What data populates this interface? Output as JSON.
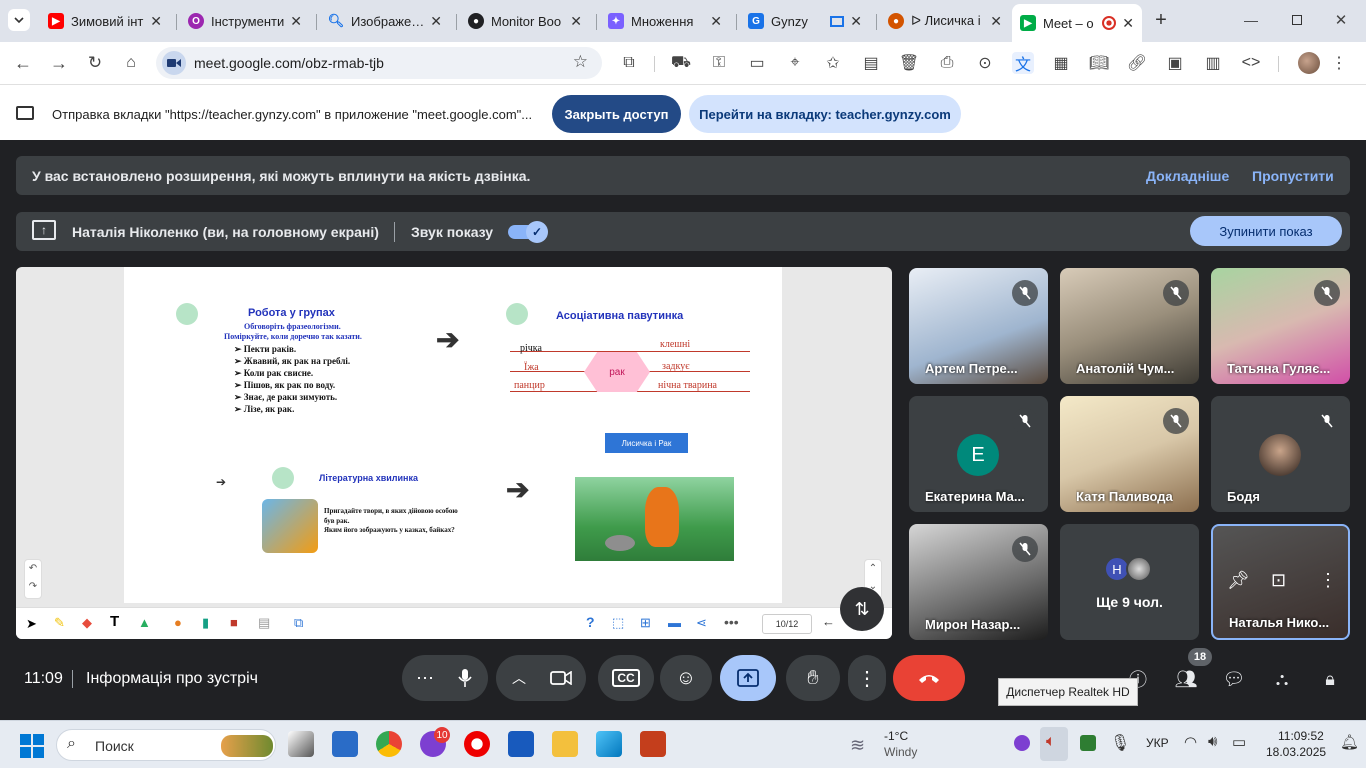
{
  "browser": {
    "tabs": [
      {
        "title": "Зимовий інт",
        "favicon": "youtube-icon",
        "color": "#ff0000"
      },
      {
        "title": "Інструменти",
        "favicon": "opera-icon",
        "color": "#9c27b0"
      },
      {
        "title": "Изображени",
        "favicon": "search-icon",
        "color": "#1a73e8"
      },
      {
        "title": "Monitor Boo",
        "favicon": "monitor-icon",
        "color": "#202124"
      },
      {
        "title": "Множення",
        "favicon": "app-icon",
        "color": "#7b61ff"
      },
      {
        "title": "Gynzy",
        "favicon": "gynzy-icon",
        "color": "#1a73e8"
      },
      {
        "title": "ᐅ Лисичка і",
        "favicon": "acorn-icon",
        "color": "#d35400"
      },
      {
        "title": "Meet – o",
        "favicon": "meet-icon",
        "color": "#00ac47"
      }
    ],
    "url": "meet.google.com/obz-rmab-tjb"
  },
  "infobar": {
    "message": "Отправка вкладки \"https://teacher.gynzy.com\" в приложение \"meet.google.com\"...",
    "stop_label": "Закрыть доступ",
    "goto_label": "Перейти на вкладку: teacher.gynzy.com"
  },
  "meet": {
    "extension_warning": "У вас встановлено розширення, які можуть вплинути на якість дзвінка.",
    "learn_more": "Докладніше",
    "skip": "Пропустити",
    "presenter": "Наталія Ніколенко (ви, на головному екрані)",
    "share_audio": "Звук показу",
    "stop_presenting": "Зупинити показ",
    "time": "11:09",
    "meeting_info": "Інформація про зустріч",
    "participant_count": "18",
    "tooltip": "Диспетчер Realtek HD",
    "participants": [
      {
        "name": "Артем Петре...",
        "muted": true
      },
      {
        "name": "Анатолій Чум...",
        "muted": true
      },
      {
        "name": "Татьяна Гуляє...",
        "muted": true
      },
      {
        "name": "Екатерина Ма...",
        "muted": true,
        "initial": "Е",
        "color": "#00897b"
      },
      {
        "name": "Катя Паливода",
        "muted": true
      },
      {
        "name": "Бодя",
        "muted": true
      },
      {
        "name": "Мирон Назар...",
        "muted": true
      },
      {
        "name": "Ще 9 чол.",
        "initial": "Н",
        "color": "#3f51b5"
      },
      {
        "name": "Наталья Нико..."
      }
    ]
  },
  "slide": {
    "title1": "Робота у групах",
    "subtitle1": "Обговоріть фразеологізми.",
    "subtitle2": "Поміркуйте, коли доречно так казати.",
    "idioms": [
      "Пекти раків.",
      "Жвавий, як рак на греблі.",
      "Коли рак свисне.",
      "Пішов, як рак по воду.",
      "Знає, де раки зимують.",
      "Лізе, як рак."
    ],
    "title2": "Асоціативна павутинка",
    "web_center": "рак",
    "web_words": [
      "річка",
      "клешні",
      "Їжа",
      "задкує",
      "панцир",
      "нічна тварина"
    ],
    "button": "Лисичка і Рак",
    "title3": "Літературна хвилинка",
    "lit1": "Пригадайте твори, в яких дійовою особою",
    "lit2": "був рак.",
    "lit3": "Яким його зображують у казках, байках?",
    "page": "10/12"
  },
  "taskbar": {
    "search": "Поиск",
    "temp": "-1°C",
    "weather": "Windy",
    "lang": "УКР",
    "time": "11:09:52",
    "date": "18.03.2025",
    "viber_badge": "10"
  }
}
